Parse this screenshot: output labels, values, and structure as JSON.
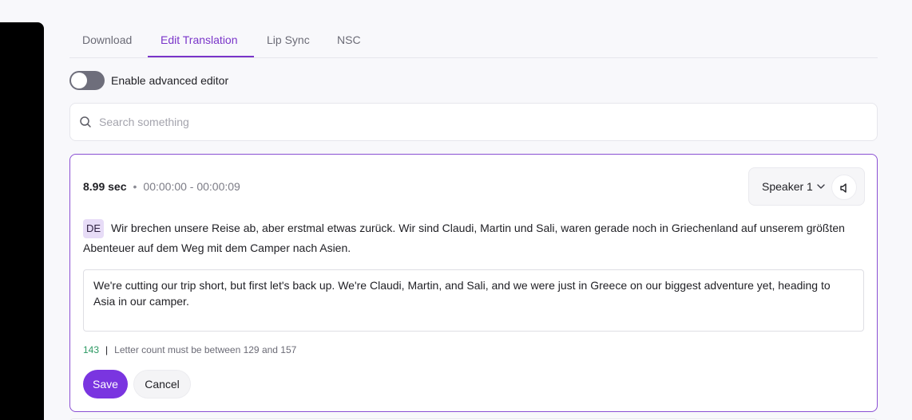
{
  "tabs": [
    {
      "label": "Download",
      "active": false
    },
    {
      "label": "Edit Translation",
      "active": true
    },
    {
      "label": "Lip Sync",
      "active": false
    },
    {
      "label": "NSC",
      "active": false
    }
  ],
  "advanced_editor": {
    "label": "Enable advanced editor",
    "enabled": false
  },
  "search": {
    "placeholder": "Search something",
    "value": ""
  },
  "segment": {
    "duration": "8.99 sec",
    "separator": "•",
    "time_range": "00:00:00 - 00:00:09",
    "speaker": "Speaker 1",
    "source_lang": "DE",
    "source_text": "Wir brechen unsere Reise ab, aber erstmal etwas zurück. Wir sind Claudi, Martin und Sali, waren gerade noch in Griechenland auf unserem größten Abenteuer auf dem Weg mit dem Camper nach Asien.",
    "translation": "We're cutting our trip short, but first let's back up. We're Claudi, Martin, and Sali, and we were just in Greece on our biggest adventure yet, heading to Asia in our camper.",
    "letter_count": "143",
    "count_separator": "|",
    "count_hint": "Letter count must be between 129 and 157",
    "save_label": "Save",
    "cancel_label": "Cancel"
  },
  "colors": {
    "accent": "#7a35c9",
    "count_ok": "#2d9a63"
  }
}
